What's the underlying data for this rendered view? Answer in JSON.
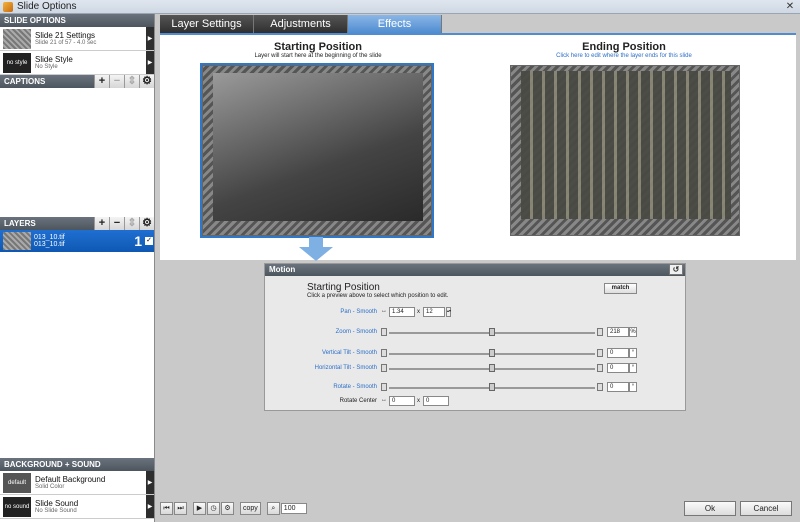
{
  "window": {
    "title": "Slide Options",
    "close": "✕"
  },
  "left": {
    "slide_options": {
      "header": "SLIDE OPTIONS",
      "settings": {
        "title": "Slide 21 Settings",
        "subtitle": "Slide 21 of 57 - 4.0 sec"
      },
      "style": {
        "thumb": "no style",
        "title": "Slide Style",
        "subtitle": "No Style"
      }
    },
    "captions": {
      "header": "CAPTIONS"
    },
    "layers": {
      "header": "LAYERS",
      "items": [
        {
          "name": "013_10.tif",
          "sub": "013_10.tif",
          "number": "1"
        }
      ]
    },
    "background_sound": {
      "header": "BACKGROUND + SOUND",
      "background": {
        "thumb": "default",
        "title": "Default Background",
        "subtitle": "Solid Color"
      },
      "sound": {
        "thumb": "no sound",
        "title": "Slide Sound",
        "subtitle": "No Slide Sound"
      }
    }
  },
  "tabs": [
    "Layer Settings",
    "Adjustments",
    "Effects"
  ],
  "active_tab": "Effects",
  "preview": {
    "start": {
      "title": "Starting Position",
      "sub": "Layer will start here at the beginning of the slide"
    },
    "end": {
      "title": "Ending Position",
      "sub": "Click here to edit where the layer ends for this slide"
    }
  },
  "motion": {
    "header": "Motion",
    "title": "Starting Position",
    "subtitle": "Click a preview above to select which position to edit.",
    "match_label": "match",
    "pan": {
      "label": "Pan - Smooth",
      "x": "1.34",
      "y": "12"
    },
    "zoom": {
      "label": "Zoom - Smooth",
      "value": "218",
      "unit": "%",
      "level": 0.5
    },
    "vtilt": {
      "label": "Vertical Tilt - Smooth",
      "value": "0",
      "unit": "°",
      "level": 0.5
    },
    "htilt": {
      "label": "Horizontal Tilt - Smooth",
      "value": "0",
      "unit": "°",
      "level": 0.5
    },
    "rotate": {
      "label": "Rotate - Smooth",
      "value": "0",
      "unit": "°",
      "level": 0.5
    },
    "rotate_center": {
      "label": "Rotate Center",
      "x": "0",
      "y": "0"
    },
    "x_sep": "x"
  },
  "toolbar": {
    "copy_label": "copy",
    "zoom_value": "100"
  },
  "buttons": {
    "ok": "Ok",
    "cancel": "Cancel"
  },
  "colors": {
    "accent": "#4f8cd0",
    "selection": "#0e58b3",
    "link": "#2c6fc8"
  }
}
